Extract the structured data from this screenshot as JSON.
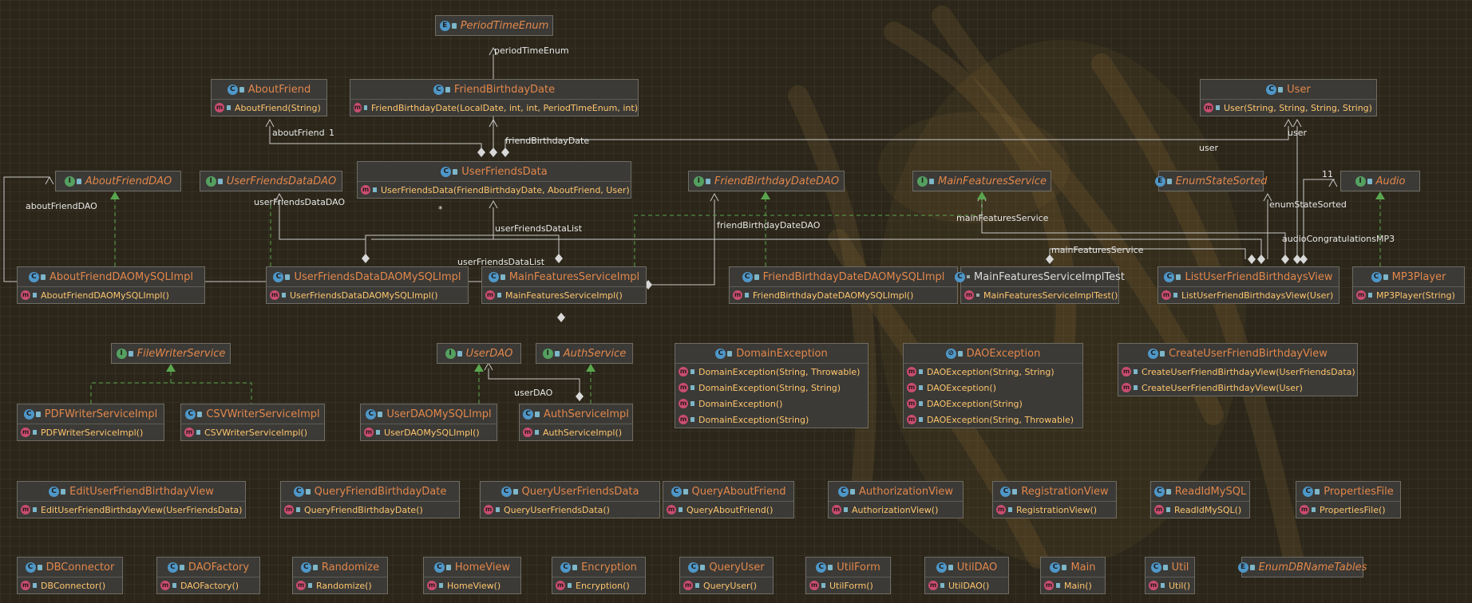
{
  "colors": {
    "background": "#2b2619",
    "class_name": "#e2874a",
    "method_name": "#ffc66d",
    "edge_solid": "#c8c8c8",
    "edge_dashed": "#5aa64f",
    "class_badge": "#4f97c8",
    "interface_badge": "#55a060",
    "method_badge": "#c94d70"
  },
  "classes": [
    {
      "name": "PeriodTimeEnum",
      "kind": "enum",
      "italic": true,
      "methods": []
    },
    {
      "name": "AboutFriend",
      "kind": "class",
      "methods": [
        {
          "name": "AboutFriend",
          "params": "(String)"
        }
      ]
    },
    {
      "name": "FriendBirthdayDate",
      "kind": "class",
      "methods": [
        {
          "name": "FriendBirthdayDate",
          "params": "(LocalDate, int, int, PeriodTimeEnum, int)"
        }
      ]
    },
    {
      "name": "User",
      "kind": "class",
      "methods": [
        {
          "name": "User",
          "params": "(String, String, String, String)"
        }
      ]
    },
    {
      "name": "AboutFriendDAO",
      "kind": "interface",
      "italic": true,
      "methods": []
    },
    {
      "name": "UserFriendsDataDAO",
      "kind": "interface",
      "italic": true,
      "methods": []
    },
    {
      "name": "UserFriendsData",
      "kind": "class",
      "methods": [
        {
          "name": "UserFriendsData",
          "params": "(FriendBirthdayDate, AboutFriend, User)"
        }
      ]
    },
    {
      "name": "FriendBirthdayDateDAO",
      "kind": "interface",
      "italic": true,
      "methods": []
    },
    {
      "name": "MainFeaturesService",
      "kind": "interface",
      "italic": true,
      "methods": []
    },
    {
      "name": "EnumStateSorted",
      "kind": "enum",
      "italic": true,
      "methods": []
    },
    {
      "name": "Audio",
      "kind": "interface",
      "italic": true,
      "methods": []
    },
    {
      "name": "AboutFriendDAOMySQLImpl",
      "kind": "class",
      "methods": [
        {
          "name": "AboutFriendDAOMySQLImpl",
          "params": " ()"
        }
      ]
    },
    {
      "name": "UserFriendsDataDAOMySQLImpl",
      "kind": "class",
      "methods": [
        {
          "name": "UserFriendsDataDAOMySQLImpl",
          "params": " ()"
        }
      ]
    },
    {
      "name": "MainFeaturesServiceImpl",
      "kind": "class",
      "methods": [
        {
          "name": "MainFeaturesServiceImpl",
          "params": " ()"
        }
      ]
    },
    {
      "name": "FriendBirthdayDateDAOMySQLImpl",
      "kind": "class",
      "methods": [
        {
          "name": "FriendBirthdayDateDAOMySQLImpl",
          "params": " ()"
        }
      ]
    },
    {
      "name": "MainFeaturesServiceImplTest",
      "kind": "test",
      "methods": [
        {
          "name": "MainFeaturesServiceImplTest",
          "params": " ()"
        }
      ]
    },
    {
      "name": "ListUserFriendBirthdaysView",
      "kind": "class",
      "methods": [
        {
          "name": "ListUserFriendBirthdaysView",
          "params": "(User)"
        }
      ]
    },
    {
      "name": "MP3Player",
      "kind": "class",
      "methods": [
        {
          "name": "MP3Player",
          "params": " (String)"
        }
      ]
    },
    {
      "name": "FileWriterService",
      "kind": "interface",
      "italic": true,
      "methods": []
    },
    {
      "name": "UserDAO",
      "kind": "interface",
      "italic": true,
      "methods": []
    },
    {
      "name": "AuthService",
      "kind": "interface",
      "italic": true,
      "methods": []
    },
    {
      "name": "DomainException",
      "kind": "class",
      "methods": [
        {
          "name": "DomainException",
          "params": " (String, Throwable)"
        },
        {
          "name": "DomainException",
          "params": " (String, String)"
        },
        {
          "name": "DomainException",
          "params": " ()"
        },
        {
          "name": "DomainException",
          "params": " (String)"
        }
      ]
    },
    {
      "name": "DAOException",
      "kind": "exception",
      "methods": [
        {
          "name": "DAOException",
          "params": " (String, String)"
        },
        {
          "name": "DAOException",
          "params": " ()"
        },
        {
          "name": "DAOException",
          "params": " (String)"
        },
        {
          "name": "DAOException",
          "params": " (String, Throwable)"
        }
      ]
    },
    {
      "name": "CreateUserFriendBirthdayView",
      "kind": "class",
      "methods": [
        {
          "name": "CreateUserFriendBirthdayView",
          "params": " (UserFriendsData)"
        },
        {
          "name": "CreateUserFriendBirthdayView",
          "params": " (User)"
        }
      ]
    },
    {
      "name": "PDFWriterServiceImpl",
      "kind": "class",
      "methods": [
        {
          "name": "PDFWriterServiceImpl",
          "params": " ()"
        }
      ]
    },
    {
      "name": "CSVWriterServiceImpl",
      "kind": "class",
      "methods": [
        {
          "name": "CSVWriterServiceImpl",
          "params": " ()"
        }
      ]
    },
    {
      "name": "UserDAOMySQLImpl",
      "kind": "class",
      "methods": [
        {
          "name": "UserDAOMySQLImpl",
          "params": " ()"
        }
      ]
    },
    {
      "name": "AuthServiceImpl",
      "kind": "class",
      "methods": [
        {
          "name": "AuthServiceImpl",
          "params": " ()"
        }
      ]
    },
    {
      "name": "EditUserFriendBirthdayView",
      "kind": "class",
      "methods": [
        {
          "name": "EditUserFriendBirthdayView",
          "params": " (UserFriendsData)"
        }
      ]
    },
    {
      "name": "QueryFriendBirthdayDate",
      "kind": "class",
      "methods": [
        {
          "name": "QueryFriendBirthdayDate",
          "params": " ()"
        }
      ]
    },
    {
      "name": "QueryUserFriendsData",
      "kind": "class",
      "methods": [
        {
          "name": "QueryUserFriendsData",
          "params": " ()"
        }
      ]
    },
    {
      "name": "QueryAboutFriend",
      "kind": "class",
      "methods": [
        {
          "name": "QueryAboutFriend",
          "params": " ()"
        }
      ]
    },
    {
      "name": "AuthorizationView",
      "kind": "class",
      "methods": [
        {
          "name": "AuthorizationView",
          "params": " ()"
        }
      ]
    },
    {
      "name": "RegistrationView",
      "kind": "class",
      "methods": [
        {
          "name": "RegistrationView",
          "params": " ()"
        }
      ]
    },
    {
      "name": "ReadIdMySQL",
      "kind": "class",
      "methods": [
        {
          "name": "ReadIdMySQL",
          "params": " ()"
        }
      ]
    },
    {
      "name": "PropertiesFile",
      "kind": "class",
      "methods": [
        {
          "name": "PropertiesFile",
          "params": " ()"
        }
      ]
    },
    {
      "name": "DBConnector",
      "kind": "class",
      "methods": [
        {
          "name": "DBConnector",
          "params": " ()"
        }
      ]
    },
    {
      "name": "DAOFactory",
      "kind": "class",
      "methods": [
        {
          "name": "DAOFactory",
          "params": " ()"
        }
      ]
    },
    {
      "name": "Randomize",
      "kind": "class",
      "methods": [
        {
          "name": "Randomize",
          "params": " ()"
        }
      ]
    },
    {
      "name": "HomeView",
      "kind": "class",
      "methods": [
        {
          "name": "HomeView",
          "params": " ()"
        }
      ]
    },
    {
      "name": "Encryption",
      "kind": "class",
      "methods": [
        {
          "name": "Encryption",
          "params": " ()"
        }
      ]
    },
    {
      "name": "QueryUser",
      "kind": "class",
      "methods": [
        {
          "name": "QueryUser",
          "params": " ()"
        }
      ]
    },
    {
      "name": "UtilForm",
      "kind": "class",
      "methods": [
        {
          "name": "UtilForm",
          "params": " ()"
        }
      ]
    },
    {
      "name": "UtilDAO",
      "kind": "class",
      "methods": [
        {
          "name": "UtilDAO",
          "params": " ()"
        }
      ]
    },
    {
      "name": "Main",
      "kind": "class",
      "methods": [
        {
          "name": "Main",
          "params": " ()"
        }
      ]
    },
    {
      "name": "Util",
      "kind": "class",
      "methods": [
        {
          "name": "Util",
          "params": " ()"
        }
      ]
    },
    {
      "name": "EnumDBNameTables",
      "kind": "enum",
      "italic": true,
      "methods": []
    }
  ],
  "edge_labels": [
    "periodTimeEnum",
    "aboutFriend",
    "friendBirthdayDate",
    "user",
    "aboutFriendDAO",
    "userFriendsDataDAO",
    "userFriendsDataList",
    "friendBirthdayDateDAO",
    "mainFeaturesService",
    "enumStateSorted",
    "audioCongratulationsMP3",
    "userFriendsDataList",
    "mainFeaturesService",
    "userDAO",
    "user",
    "1",
    "*",
    "11"
  ]
}
